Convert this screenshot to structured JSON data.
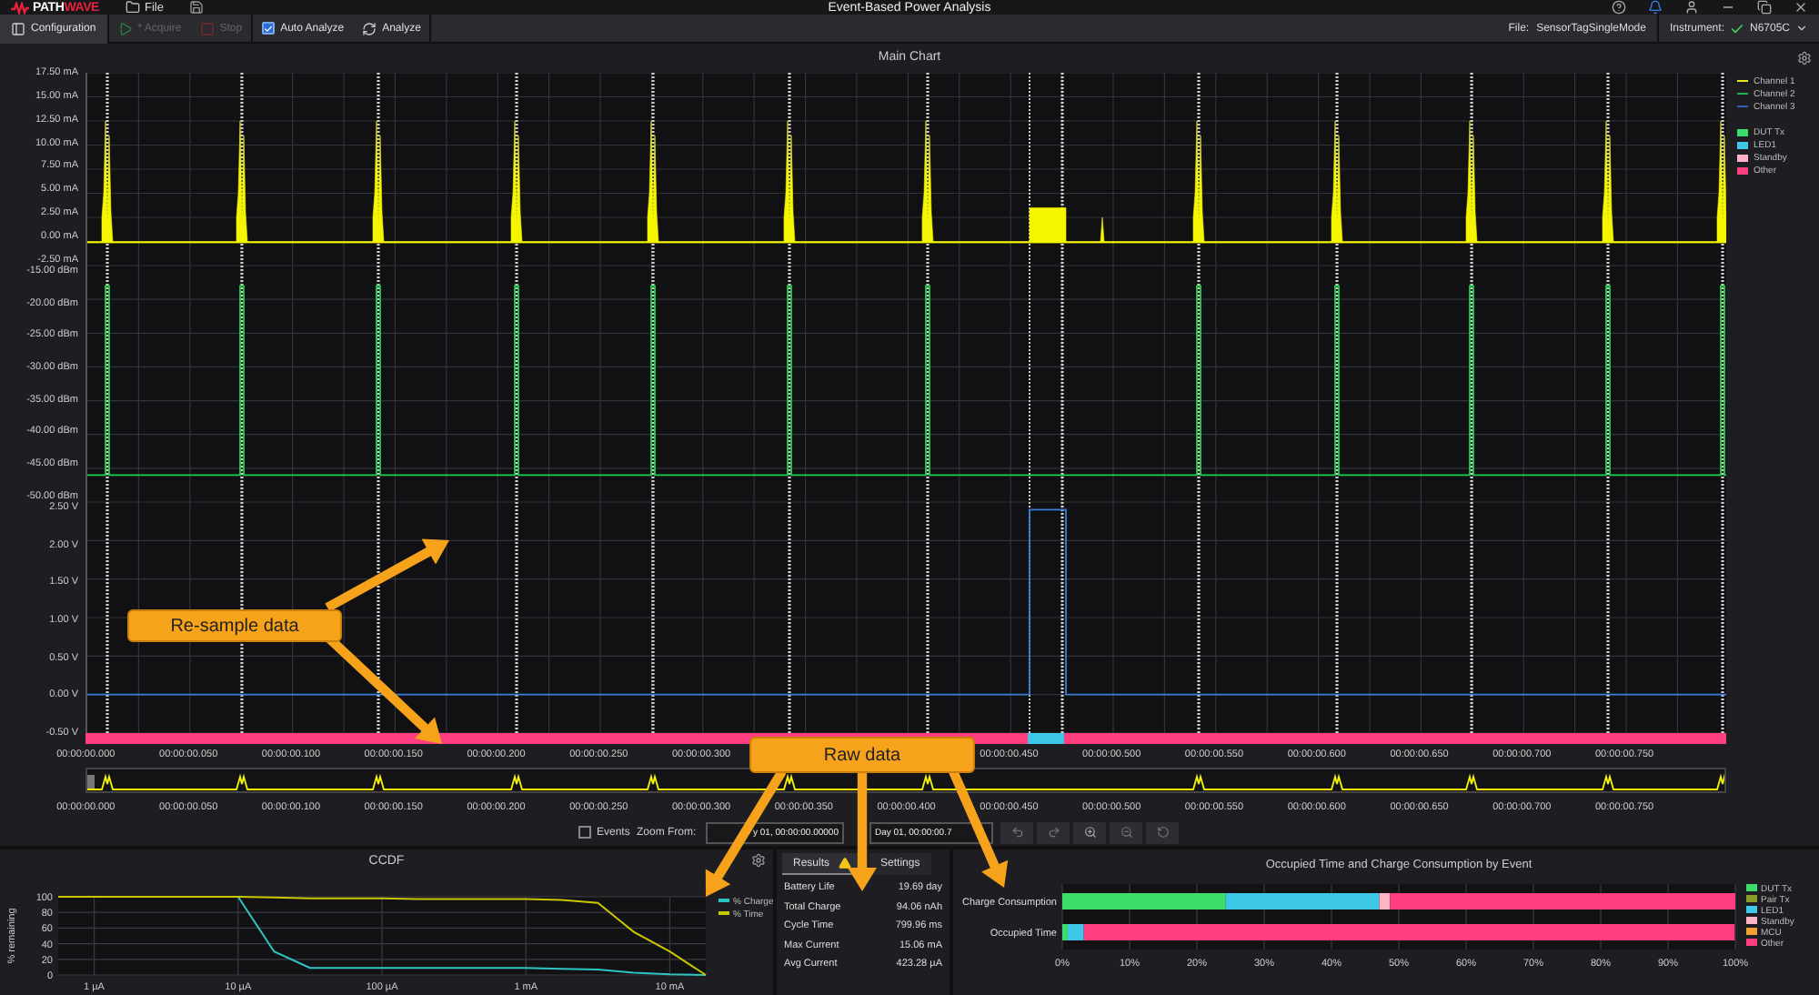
{
  "app": {
    "logo": {
      "part_1": "PATH",
      "part_2": "WAVE"
    },
    "menu": [
      {
        "label": "File"
      }
    ],
    "title": "Event-Based Power Analysis"
  },
  "toolbar": {
    "items": [
      {
        "kind": "panel",
        "label": "Configuration",
        "disabled": false
      },
      {
        "kind": "play",
        "label": "* Acquire",
        "disabled": true
      },
      {
        "kind": "stop",
        "label": "Stop",
        "disabled": true
      },
      {
        "kind": "check",
        "label": "Auto Analyze",
        "checked": true
      },
      {
        "kind": "refresh",
        "label": "Analyze",
        "disabled": false
      }
    ],
    "file_label": "File:",
    "file_name": "SensorTagSingleMode",
    "instrument_label": "Instrument:",
    "instrument": "N6705C"
  },
  "main_chart": {
    "title": "Main Chart",
    "panels": [
      {
        "kind": "current",
        "color": "#f5f500",
        "yticks": [
          "17.50 mA",
          "15.00 mA",
          "12.50 mA",
          "10.00 mA",
          "7.50 mA",
          "5.00 mA",
          "2.50 mA",
          "0.00 mA",
          "-2.50 mA"
        ]
      },
      {
        "kind": "power",
        "color": "#1fd14a",
        "yticks": [
          "-15.00 dBm",
          "-20.00 dBm",
          "-25.00 dBm",
          "-30.00 dBm",
          "-35.00 dBm",
          "-40.00 dBm",
          "-45.00 dBm",
          "-50.00 dBm"
        ]
      },
      {
        "kind": "voltage",
        "color": "#3a7fd8",
        "yticks": [
          "2.50 V",
          "2.00 V",
          "1.50 V",
          "1.00 V",
          "0.50 V",
          "0.00 V",
          "-0.50 V"
        ]
      }
    ],
    "channels": [
      {
        "label": "Channel 1",
        "color": "#e8e81a"
      },
      {
        "label": "Channel 2",
        "color": "#22b04a"
      },
      {
        "label": "Channel 3",
        "color": "#2f62b8"
      }
    ],
    "events": [
      {
        "label": "DUT Tx",
        "color": "#3ddc6a"
      },
      {
        "label": "LED1",
        "color": "#3cc8e6"
      },
      {
        "label": "Standby",
        "color": "#ffb3c6"
      },
      {
        "label": "Other",
        "color": "#ff3d7f"
      }
    ],
    "time_ticks_left": [
      "00:00:00.000",
      "00:00:00.050",
      "00:00:00.100",
      "00:00:00.150",
      "00:00:00.200",
      "00:00:00.250",
      "00:00:00.300"
    ],
    "time_ticks_right": [
      "00:00:00.450",
      "00:00:00.500",
      "00:00:00.550",
      "00:00:00.600",
      "00:00:00.650",
      "00:00:00.700",
      "00:00:00.750"
    ],
    "overview_ticks": [
      "00:00:00.000",
      "00:00:00.050",
      "00:00:00.100",
      "00:00:00.150",
      "00:00:00.200",
      "00:00:00.250",
      "00:00:00.300",
      "00:00:00.350",
      "00:00:00.400",
      "00:00:00.450",
      "00:00:00.500",
      "00:00:00.550",
      "00:00:00.600",
      "00:00:00.650",
      "00:00:00.700",
      "00:00:00.750"
    ]
  },
  "zoom_bar": {
    "events": {
      "label": "Events",
      "checked": false
    },
    "zoom_label": "Zoom From:",
    "from": "y 01, 00:00:00.00000",
    "to": "Day 01, 00:00:00.7"
  },
  "ccdf": {
    "title": "CCDF",
    "chart_data": {
      "type": "line",
      "ylabel": "% remaining",
      "categories": [
        null,
        "1 µA",
        null,
        null,
        null,
        "10 µA",
        null,
        null,
        null,
        "100 µA",
        null,
        null,
        null,
        "1 mA",
        null,
        null,
        null,
        "10 mA",
        null
      ],
      "series": [
        {
          "name": "% Charge",
          "color": "#2ec4c4",
          "values": [
            null,
            null,
            null,
            null,
            null,
            100,
            30,
            9,
            9,
            9,
            9,
            9,
            9,
            9,
            8,
            7,
            3,
            1,
            0
          ]
        },
        {
          "name": "% Time",
          "color": "#c8c800",
          "values": [
            100,
            100,
            100,
            100,
            100,
            100,
            99,
            98,
            98,
            98,
            97,
            97,
            97,
            97,
            96,
            92,
            55,
            30,
            0
          ]
        }
      ],
      "ylim": [
        0,
        100
      ],
      "yticks": [
        0,
        20,
        40,
        60,
        80,
        100
      ],
      "grid": true,
      "legend": "right"
    }
  },
  "results": {
    "tabs": [
      {
        "label": "Results",
        "selected": true,
        "warning": true
      },
      {
        "label": "Settings",
        "selected": false,
        "warning": false
      }
    ],
    "rows": [
      {
        "label": "Battery Life",
        "value": "19.69 day"
      },
      {
        "label": "Total Charge",
        "value": "94.06 nAh"
      },
      {
        "label": "Cycle Time",
        "value": "799.96 ms"
      },
      {
        "label": "Max Current",
        "value": "15.06 mA"
      },
      {
        "label": "Avg Current",
        "value": "423.28 µA"
      }
    ]
  },
  "occupancy": {
    "chart_data": {
      "type": "bar",
      "orientation": "horizontal",
      "stacked": true,
      "title": "Occupied Time and Charge Consumption by Event",
      "categories": [
        "Charge Consumption",
        "Occupied Time"
      ],
      "series": [
        {
          "name": "DUT Tx",
          "color": "#3ddc6a",
          "values": [
            24.3,
            0.8
          ]
        },
        {
          "name": "Pair Tx",
          "color": "#8a9a2a",
          "values": [
            0,
            0
          ]
        },
        {
          "name": "LED1",
          "color": "#3cc8e6",
          "values": [
            22.8,
            2.4
          ]
        },
        {
          "name": "Standby",
          "color": "#ffb3c6",
          "values": [
            1.6,
            null
          ]
        },
        {
          "name": "MCU",
          "color": "#f0a030",
          "values": [
            0,
            0
          ]
        },
        {
          "name": "Other",
          "color": "#ff3d7f",
          "values": [
            51.3,
            96.7
          ]
        }
      ],
      "xlim": [
        0,
        100
      ],
      "grid": true,
      "legend": "right",
      "xticks": [
        {
          "value": 0,
          "label": "0%"
        },
        {
          "value": 10,
          "label": "10%"
        },
        {
          "value": 20,
          "label": "20%"
        },
        {
          "value": 30,
          "label": "30%"
        },
        {
          "value": 40,
          "label": "40%"
        },
        {
          "value": 50,
          "label": "50%"
        },
        {
          "value": 60,
          "label": "60%"
        },
        {
          "value": 70,
          "label": "70%"
        },
        {
          "value": 80,
          "label": "80%"
        },
        {
          "value": 90,
          "label": "90%"
        },
        {
          "value": 100,
          "label": "100%"
        }
      ]
    }
  },
  "callouts": [
    {
      "label": "Re-sample data"
    },
    {
      "label": "Raw data"
    }
  ]
}
